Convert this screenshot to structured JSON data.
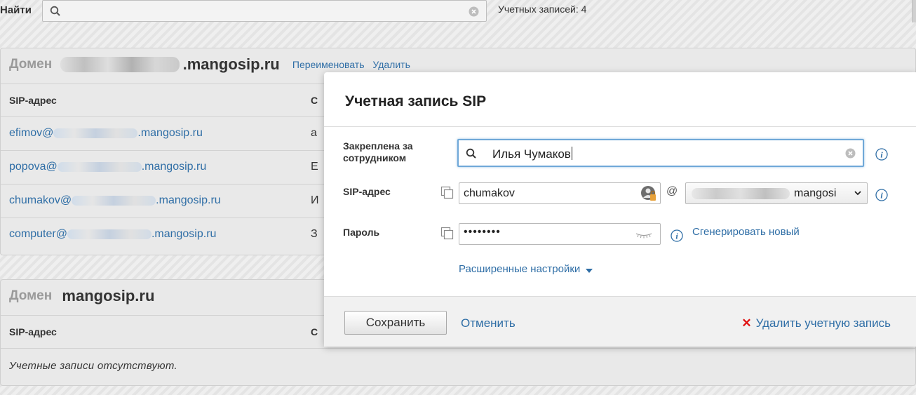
{
  "topbar": {
    "find_label": "Найти",
    "accounts_count": "Учетных записей: 4"
  },
  "domains": [
    {
      "word": "Домен",
      "name": ".mangosip.ru",
      "rename": "Переименовать",
      "delete": "Удалить",
      "col_sip": "SIP-адрес",
      "col2_initial": "С",
      "rows": [
        {
          "user": "efimov@",
          "suffix": ".mangosip.ru",
          "col2": "а"
        },
        {
          "user": "popova@",
          "suffix": ".mangosip.ru",
          "col2": "Е"
        },
        {
          "user": "chumakov@",
          "suffix": ".mangosip.ru",
          "col2": "И"
        },
        {
          "user": "computer@",
          "suffix": ".mangosip.ru",
          "col2": "З"
        }
      ]
    },
    {
      "word": "Домен",
      "name": "mangosip.ru",
      "col_sip": "SIP-адрес",
      "col2_initial": "С",
      "empty": "Учетные записи отсутствуют."
    }
  ],
  "modal": {
    "title": "Учетная запись SIP",
    "assigned_label_1": "Закреплена за",
    "assigned_label_2": "сотрудником",
    "assigned_value": "Илья Чумаков",
    "sip_label": "SIP-адрес",
    "sip_value": "chumakov",
    "at": "@",
    "domain_value": "mangosi",
    "password_label": "Пароль",
    "password_value": "••••••••",
    "generate": "Сгенерировать новый",
    "advanced": "Расширенные настройки",
    "save": "Сохранить",
    "cancel": "Отменить",
    "delete_account": "Удалить учетную запись"
  },
  "colors": {
    "link": "#2f6ea6",
    "focus_border": "#6fa8d8",
    "delete_x": "#e01010"
  }
}
